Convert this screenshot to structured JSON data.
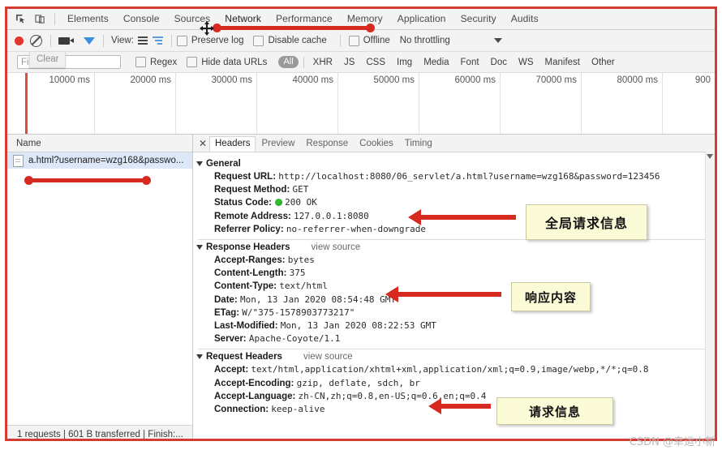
{
  "window": {
    "watermark": "CSDN @幸运小新"
  },
  "tabstrip": {
    "icons": [
      "inspect-element-icon",
      "device-toolbar-icon"
    ],
    "tabs": [
      {
        "label": "Elements",
        "active": false
      },
      {
        "label": "Console",
        "active": false
      },
      {
        "label": "Sources",
        "active": false
      },
      {
        "label": "Network",
        "active": true
      },
      {
        "label": "Performance",
        "active": false
      },
      {
        "label": "Memory",
        "active": false
      },
      {
        "label": "Application",
        "active": false
      },
      {
        "label": "Security",
        "active": false
      },
      {
        "label": "Audits",
        "active": false
      }
    ]
  },
  "network_toolbar": {
    "view_label": "View:",
    "preserve_log": "Preserve log",
    "disable_cache": "Disable cache",
    "offline": "Offline",
    "throttling": "No throttling"
  },
  "filterbar": {
    "filter_placeholder": "Filter",
    "clear_tooltip": "Clear",
    "regex": "Regex",
    "hide_data_urls": "Hide data URLs",
    "types": [
      "All",
      "XHR",
      "JS",
      "CSS",
      "Img",
      "Media",
      "Font",
      "Doc",
      "WS",
      "Manifest",
      "Other"
    ],
    "selected_type": "All"
  },
  "overview": {
    "ticks": [
      "10000 ms",
      "20000 ms",
      "30000 ms",
      "40000 ms",
      "50000 ms",
      "60000 ms",
      "70000 ms",
      "80000 ms",
      "900"
    ]
  },
  "requests_pane": {
    "column_header": "Name",
    "rows": [
      {
        "name": "a.html?username=wzg168&passwo..."
      }
    ]
  },
  "detail_pane": {
    "close_label": "✕",
    "tabs": [
      {
        "label": "Headers",
        "active": true
      },
      {
        "label": "Preview",
        "active": false
      },
      {
        "label": "Response",
        "active": false
      },
      {
        "label": "Cookies",
        "active": false
      },
      {
        "label": "Timing",
        "active": false
      }
    ],
    "view_source": "view source",
    "sections": [
      {
        "title": "General",
        "has_view_source": false,
        "rows": [
          {
            "key": "Request URL:",
            "value": "http://localhost:8080/06_servlet/a.html?username=wzg168&password=123456"
          },
          {
            "key": "Request Method:",
            "value": "GET"
          },
          {
            "key": "Status Code:",
            "value": "200 OK",
            "status_dot": true
          },
          {
            "key": "Remote Address:",
            "value": "127.0.0.1:8080"
          },
          {
            "key": "Referrer Policy:",
            "value": "no-referrer-when-downgrade"
          }
        ]
      },
      {
        "title": "Response Headers",
        "has_view_source": true,
        "rows": [
          {
            "key": "Accept-Ranges:",
            "value": "bytes"
          },
          {
            "key": "Content-Length:",
            "value": "375"
          },
          {
            "key": "Content-Type:",
            "value": "text/html"
          },
          {
            "key": "Date:",
            "value": "Mon, 13 Jan 2020 08:54:48 GMT"
          },
          {
            "key": "ETag:",
            "value": "W/\"375-1578903773217\""
          },
          {
            "key": "Last-Modified:",
            "value": "Mon, 13 Jan 2020 08:22:53 GMT"
          },
          {
            "key": "Server:",
            "value": "Apache-Coyote/1.1"
          }
        ]
      },
      {
        "title": "Request Headers",
        "has_view_source": true,
        "rows": [
          {
            "key": "Accept:",
            "value": "text/html,application/xhtml+xml,application/xml;q=0.9,image/webp,*/*;q=0.8"
          },
          {
            "key": "Accept-Encoding:",
            "value": "gzip, deflate, sdch, br"
          },
          {
            "key": "Accept-Language:",
            "value": "zh-CN,zh;q=0.8,en-US;q=0.6,en;q=0.4"
          },
          {
            "key": "Connection:",
            "value": "keep-alive"
          }
        ]
      }
    ]
  },
  "statusbar": {
    "text": "1 requests | 601 B transferred | Finish:..."
  },
  "annotations": {
    "accent_color": "#d62a21",
    "callout_bg": "#fbfbd8",
    "callouts": [
      {
        "text": "全局请求信息"
      },
      {
        "text": "响应内容"
      },
      {
        "text": "请求信息"
      }
    ]
  }
}
